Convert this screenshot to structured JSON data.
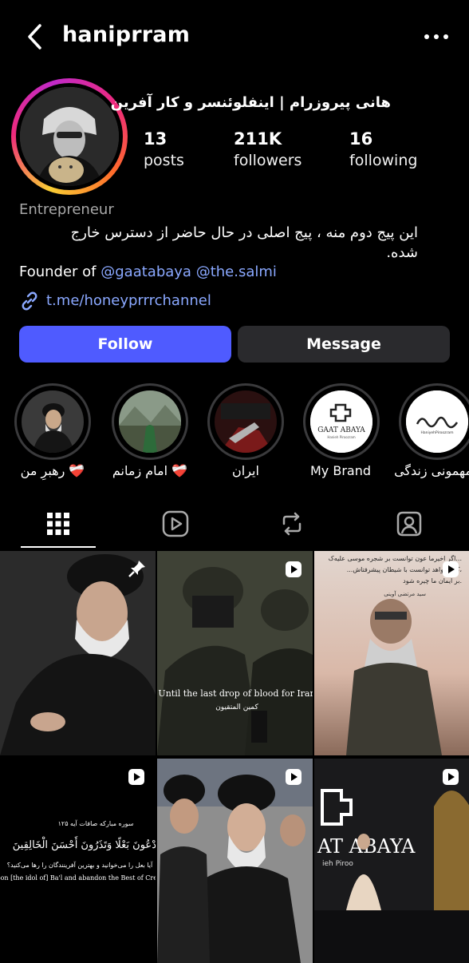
{
  "header": {
    "username": "haniprram",
    "back_icon": "chevron-left-icon",
    "more_icon": "more-horizontal-icon"
  },
  "profile": {
    "full_name": "هانی پیروزرام | اینفلوئنسر و کار آفرین",
    "stats": [
      {
        "value": "13",
        "label": "posts"
      },
      {
        "value": "211K",
        "label": "followers"
      },
      {
        "value": "16",
        "label": "following"
      }
    ],
    "category": "Entrepreneur",
    "bio_line1": "این پیج دوم منه ، پیج اصلی در حال حاضر از دسترس خارج",
    "bio_line2": "شده.",
    "founder_prefix": "Founder of",
    "founder_mentions": [
      "@gaatabaya",
      "@the.salmi"
    ],
    "link": "t.me/honeyprrrchannel"
  },
  "actions": {
    "follow": "Follow",
    "message": "Message"
  },
  "highlights": [
    {
      "label": "رهبرِ من ❤️‍🩹"
    },
    {
      "label": "امام زمانم ❤️‍🩹"
    },
    {
      "label": "ایران"
    },
    {
      "label": "My Brand"
    },
    {
      "label": "مهمونی زندگی"
    }
  ],
  "highlight_logos": {
    "gaat_main": "GAAT ABAYA",
    "gaat_sub": "Hanieh Piroozram",
    "hanieh_sub": "HaniyehPiroozram"
  },
  "tabs": [
    {
      "icon": "grid-icon",
      "active": true
    },
    {
      "icon": "reels-icon",
      "active": false
    },
    {
      "icon": "repost-icon",
      "active": false
    },
    {
      "icon": "tagged-icon",
      "active": false
    }
  ],
  "posts": {
    "tile2_en": "Until the last drop of blood for Iran",
    "tile2_fa": "کمین المتقیون",
    "tile3_line1": "اگر اخیرما عون توانست بر شجره موسی علیه‌ک...",
    "tile3_line2": "...کار نخواهد توانست با شیطان پیشرفتاش،",
    "tile3_line3": "بر ایمان ما چیره شود.",
    "tile3_line4": "سید مرتضی آوینی",
    "tile4_line1": "سوره مبارکه صافات آیه ۱۲۵",
    "tile4_line2": "أَتَدْعُونَ بَعْلًا وَتَذَرُونَ أَحْسَنَ الْخَالِقِينَ",
    "tile4_line3": "آیا بعل را می‌خوانید و بهترین آفرینندگان را رها می‌کنید؟",
    "tile4_line4": "upon [the idol of] Ba'l and abandon the Best of Creators",
    "tile6_main": "AT ABAYA",
    "tile6_sub": "ieh Piroo"
  },
  "colors": {
    "background": "#000000",
    "follow_button": "#4f5bff",
    "message_button": "#2a2a2d",
    "link": "#8aa8ff",
    "secondary_text": "#a8a8a8"
  }
}
